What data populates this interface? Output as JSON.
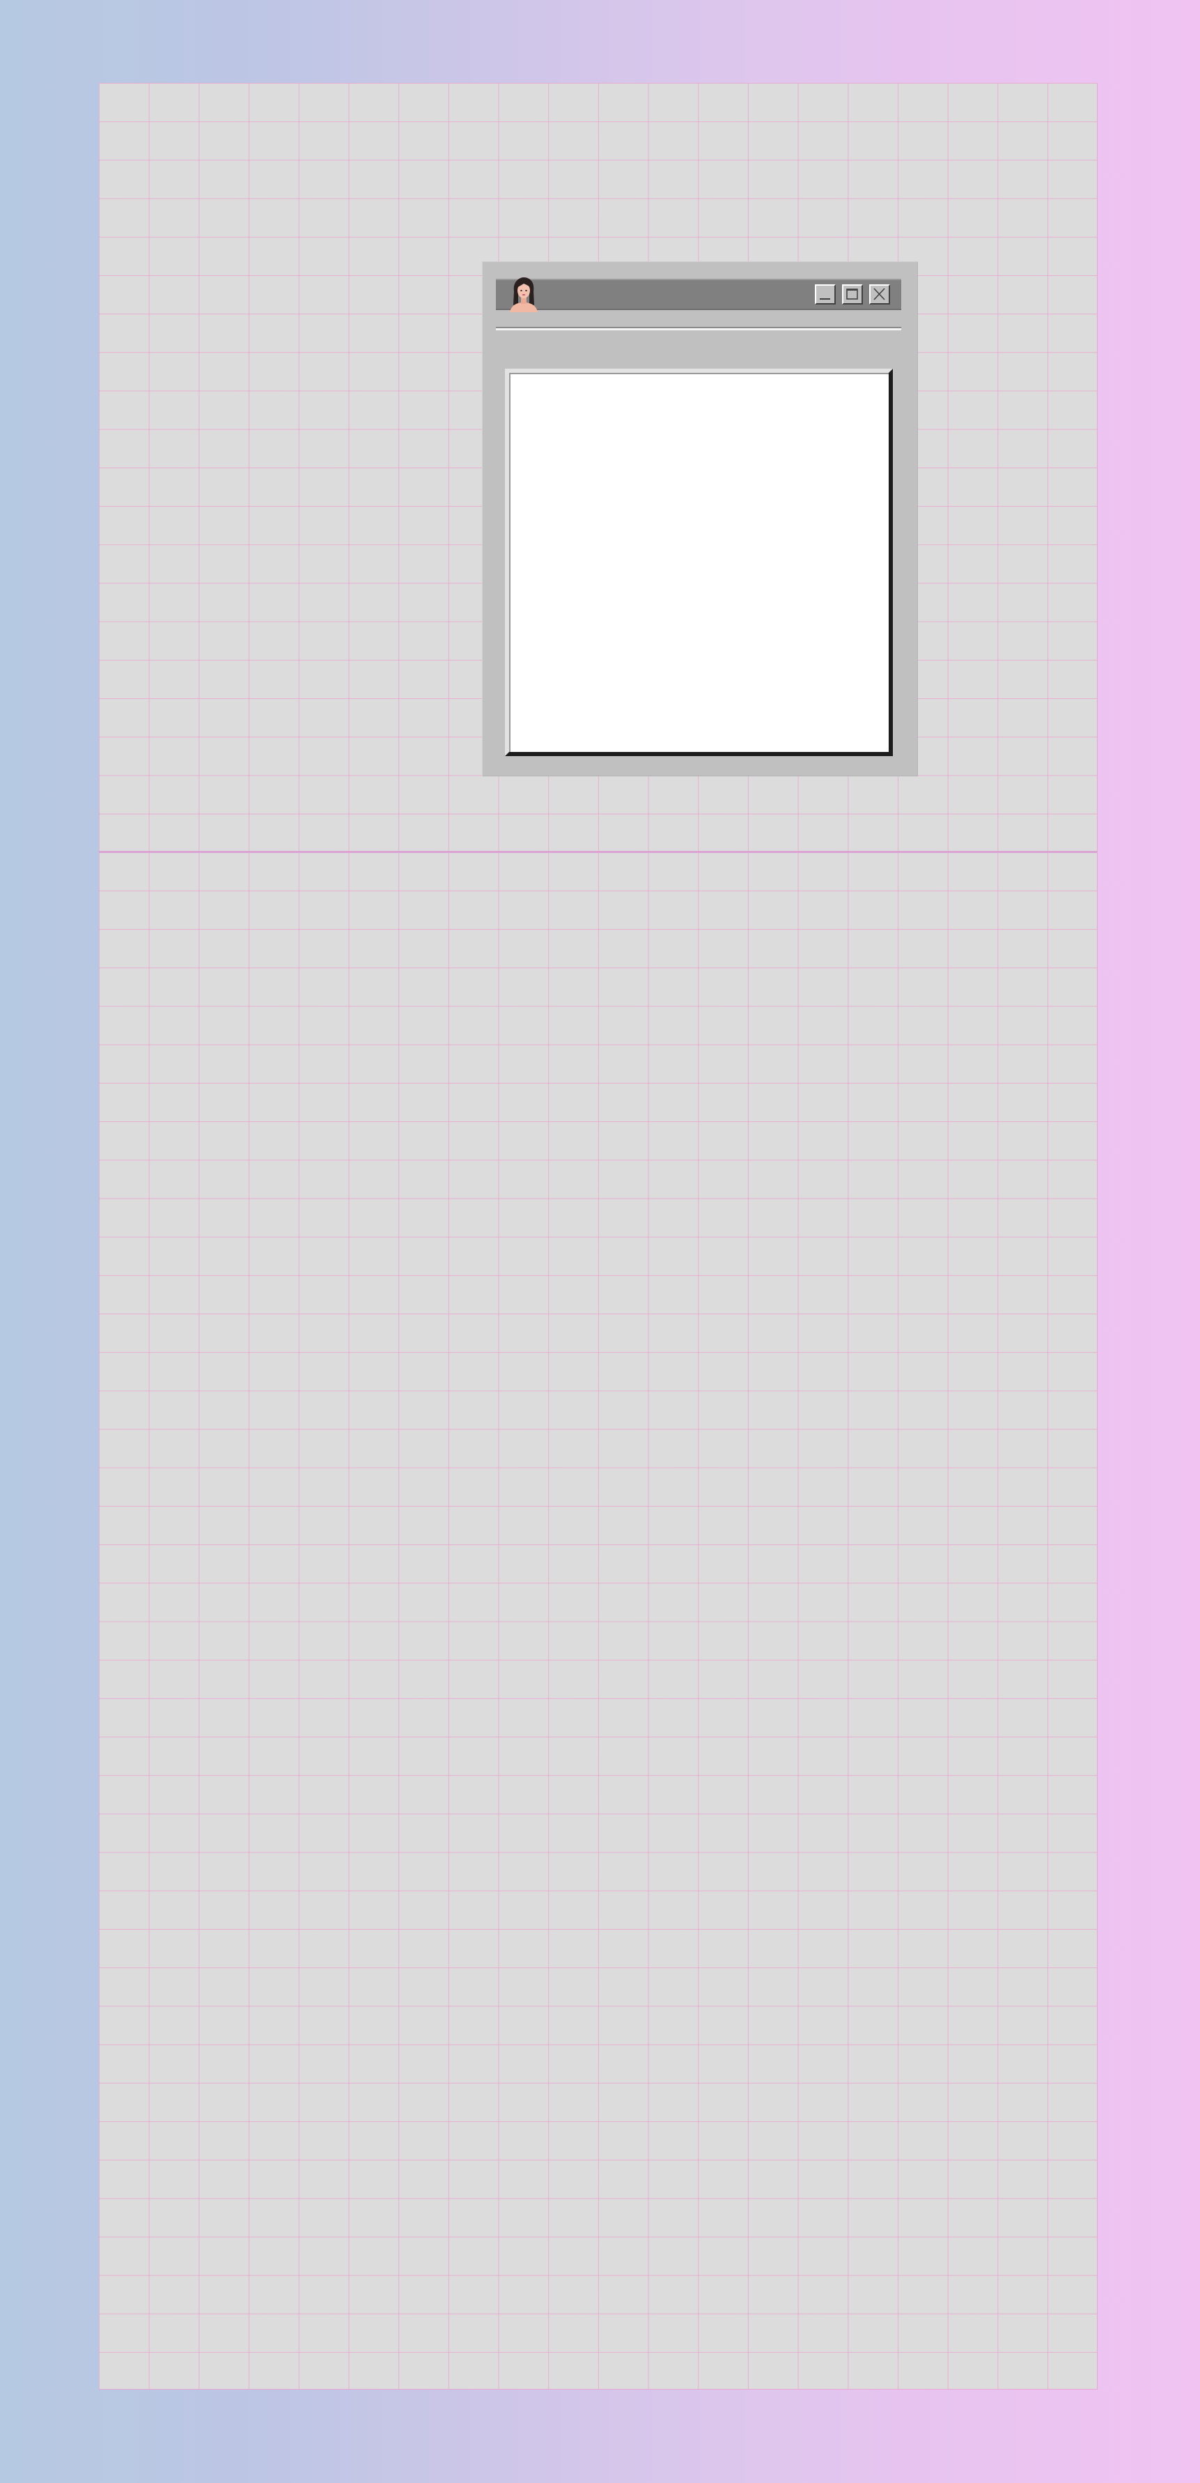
{
  "desktop": {
    "gradient_start": "#b6c9e2",
    "gradient_end": "#f0c3f2"
  },
  "sheet": {
    "background": "#dcdcdc",
    "grid_color": "#e9a0cd"
  },
  "window": {
    "title": "",
    "avatar_icon": "avatar-portrait-icon",
    "frame_color": "#c0c0c0",
    "titlebar_color": "#808080",
    "buttons": {
      "minimize_icon": "minimize-icon",
      "maximize_icon": "maximize-icon",
      "close_icon": "close-icon"
    },
    "content_text": ""
  }
}
